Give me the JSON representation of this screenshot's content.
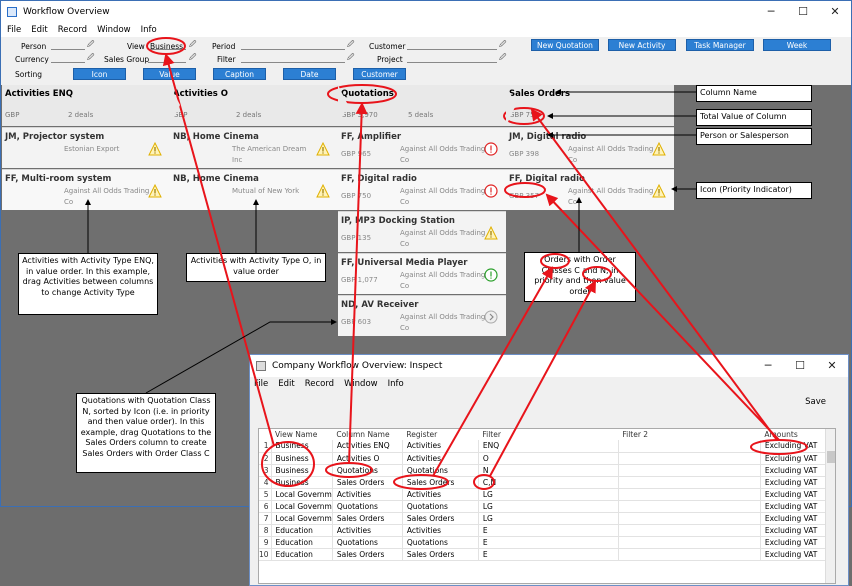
{
  "main_window": {
    "title": "Workflow Overview",
    "controls": {
      "minimize": "─",
      "maximize": "☐",
      "close": "✕"
    },
    "menu": [
      "File",
      "Edit",
      "Record",
      "Window",
      "Info"
    ]
  },
  "toolbar": {
    "person_label": "Person",
    "currency_label": "Currency",
    "sorting_label": "Sorting",
    "view_label": "View",
    "view_value": "Business",
    "sales_group_label": "Sales Group",
    "period_label": "Period",
    "filter_label": "Filter",
    "customer_label": "Customer",
    "project_label": "Project",
    "sort_buttons": [
      "Icon",
      "Value",
      "Caption",
      "Date",
      "Customer"
    ],
    "buttons": [
      "New Quotation",
      "New Activity",
      "Task Manager",
      "Week"
    ]
  },
  "columns": [
    {
      "title": "Activities ENQ",
      "total": "GBP",
      "count": "2 deals"
    },
    {
      "title": "Activities O",
      "total": "GBP",
      "count": "2 deals"
    },
    {
      "title": "Quotations",
      "total": "GBP 3,970",
      "count": "5 deals"
    },
    {
      "title": "Sales Orders",
      "total": "GBP 755",
      "count": ""
    }
  ],
  "cards": [
    [
      {
        "title": "JM, Projector system",
        "amount": "",
        "customer": "Estonian Export",
        "icon": "warning-icon"
      },
      {
        "title": "FF, Multi-room system",
        "amount": "",
        "customer": "Against All Odds Trading Co",
        "icon": "warning-icon"
      }
    ],
    [
      {
        "title": "NB, Home Cinema",
        "amount": "",
        "customer": "The American Dream Inc",
        "icon": "warning-icon"
      },
      {
        "title": "NB, Home Cinema",
        "amount": "",
        "customer": "Mutual of New York",
        "icon": "warning-icon"
      }
    ],
    [
      {
        "title": "FF, Amplifier",
        "amount": "GBP 965",
        "customer": "Against All Odds Trading Co",
        "icon": "alert-icon"
      },
      {
        "title": "FF, Digital radio",
        "amount": "GBP 750",
        "customer": "Against All Odds Trading Co",
        "icon": "alert-icon"
      },
      {
        "title": "IP, MP3 Docking Station",
        "amount": "GBP 135",
        "customer": "Against All Odds Trading Co",
        "icon": "warning-icon"
      },
      {
        "title": "FF, Universal Media Player",
        "amount": "GBP 1,077",
        "customer": "Against All Odds Trading Co",
        "icon": "ok-icon"
      },
      {
        "title": "ND, AV Receiver",
        "amount": "GBP 603",
        "customer": "Against All Odds Trading Co",
        "icon": "chevron-right-icon"
      }
    ],
    [
      {
        "title": "JM, Digital radio",
        "amount": "GBP 398",
        "customer": "Against All Odds Trading Co",
        "icon": "warning-icon"
      },
      {
        "title": "FF, Digital radio",
        "amount": "GBP 357",
        "customer": "Against All Odds Trading Co",
        "icon": "warning-icon"
      }
    ]
  ],
  "callouts": {
    "column_name": "Column Name",
    "total_value": "Total Value of Column",
    "person": "Person or Salesperson",
    "icon_priority": "Icon (Priority Indicator)",
    "activities_enq": "Activities with Activity Type ENQ, in value order. In this example, drag Activities between columns to change Activity Type",
    "activities_o": "Activities with Activity Type O, in value order",
    "orders": "Orders with Order Classes C and N, in priority and then value order",
    "quotations": "Quotations with Quotation Class N, sorted by Icon (i.e. in priority and then value order). In this example, drag Quotations to the Sales Orders column to create Sales Orders with Order Class C"
  },
  "inspect_window": {
    "title": "Company Workflow Overview: Inspect",
    "menu": [
      "File",
      "Edit",
      "Record",
      "Window",
      "Info"
    ],
    "save_label": "Save",
    "headers": [
      "",
      "View Name",
      "Column Name",
      "Register",
      "Filter",
      "Filter 2",
      "Amounts"
    ],
    "rows": [
      [
        "1",
        "Business",
        "Activities ENQ",
        "Activities",
        "ENQ",
        "",
        "Excluding VAT"
      ],
      [
        "2",
        "Business",
        "Activities O",
        "Activities",
        "O",
        "",
        "Excluding VAT"
      ],
      [
        "3",
        "Business",
        "Quotations",
        "Quotations",
        "N",
        "",
        "Excluding VAT"
      ],
      [
        "4",
        "Business",
        "Sales Orders",
        "Sales Orders",
        "C,N",
        "",
        "Excluding VAT"
      ],
      [
        "5",
        "Local Governm",
        "Activities",
        "Activities",
        "LG",
        "",
        "Excluding VAT"
      ],
      [
        "6",
        "Local Governm",
        "Quotations",
        "Quotations",
        "LG",
        "",
        "Excluding VAT"
      ],
      [
        "7",
        "Local Governm",
        "Sales Orders",
        "Sales Orders",
        "LG",
        "",
        "Excluding VAT"
      ],
      [
        "8",
        "Education",
        "Activities",
        "Activities",
        "E",
        "",
        "Excluding VAT"
      ],
      [
        "9",
        "Education",
        "Quotations",
        "Quotations",
        "E",
        "",
        "Excluding VAT"
      ],
      [
        "10",
        "Education",
        "Sales Orders",
        "Sales Orders",
        "E",
        "",
        "Excluding VAT"
      ]
    ]
  },
  "colors": {
    "accent": "#2c7fd3",
    "annotation": "#e8141b",
    "warning": "#f1c40f",
    "alert": "#e02424",
    "ok": "#2ca02c"
  }
}
